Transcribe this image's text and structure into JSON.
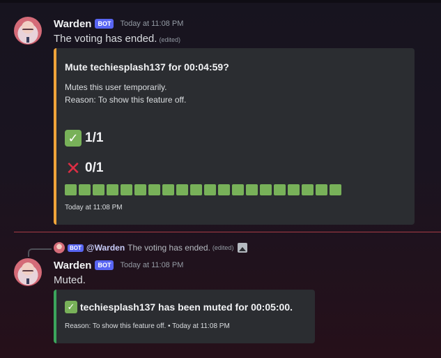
{
  "message1": {
    "username": "Warden",
    "bot_tag": "BOT",
    "timestamp": "Today at 11:08 PM",
    "content": "The voting has ended.",
    "edited": "(edited)",
    "embed": {
      "accent_color": "#f0a43a",
      "title": "Mute techiesplash137 for 00:04:59?",
      "description_line1": "Mutes this user temporarily.",
      "description_line2": "Reason: To show this feature off.",
      "yes_icon": "check-mark-icon",
      "yes_count": "1/1",
      "no_icon": "cross-mark-icon",
      "no_count": "0/1",
      "progress_fraction": 1.0,
      "progress_segments": 20,
      "progress_color": "#78b159",
      "footer": "Today at 11:08 PM"
    }
  },
  "reply": {
    "bot_tag": "BOT",
    "username": "@Warden",
    "text": "The voting has ended.",
    "edited": "(edited)",
    "attachment_icon": "image-icon"
  },
  "message2": {
    "username": "Warden",
    "bot_tag": "BOT",
    "timestamp": "Today at 11:08 PM",
    "content": "Muted.",
    "embed": {
      "accent_color": "#3ba55c",
      "title": "techiesplash137 has been muted for 00:05:00.",
      "footer": "Reason: To show this feature off. • Today at 11:08 PM"
    }
  }
}
